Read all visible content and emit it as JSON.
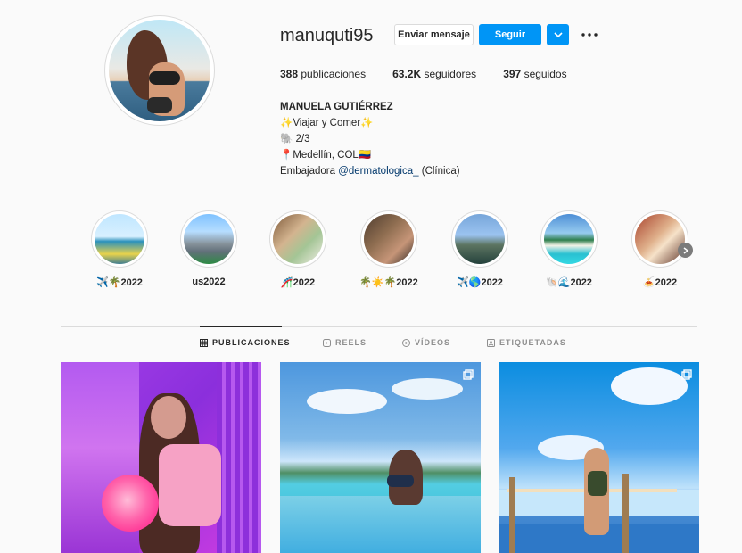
{
  "profile": {
    "username": "manuquti95",
    "buttons": {
      "message": "Enviar mensaje",
      "follow": "Seguir"
    },
    "stats": {
      "posts_count": "388",
      "posts_label": "publicaciones",
      "followers_count": "63.2K",
      "followers_label": "seguidores",
      "following_count": "397",
      "following_label": "seguidos"
    },
    "bio": {
      "name": "MANUELA GUTIÉRREZ",
      "line1": "✨Viajar y Comer✨",
      "line2": "🐘 2/3",
      "line3": "📍Medellín, COL🇨🇴",
      "line4_prefix": "Embajadora",
      "line4_link": "@dermatologica_",
      "line4_suffix": "(Clínica)"
    }
  },
  "highlights": [
    {
      "label": "✈️🌴2022"
    },
    {
      "label": "us2022"
    },
    {
      "label": "🎢2022"
    },
    {
      "label": "🌴☀️🌴2022"
    },
    {
      "label": "✈️🌎2022"
    },
    {
      "label": "🐚🌊2022"
    },
    {
      "label": "🍝2022"
    }
  ],
  "tabs": {
    "posts": "PUBLICACIONES",
    "reels": "REELS",
    "videos": "VÍDEOS",
    "tagged": "ETIQUETADAS"
  },
  "icons": {
    "more": "more-horizontal-icon",
    "dropdown": "chevron-down-icon",
    "grid": "grid-icon",
    "reels": "reels-icon",
    "video": "video-icon",
    "tagged": "tagged-icon",
    "carousel": "carousel-icon"
  },
  "colors": {
    "accent": "#0095f6",
    "link": "#00376b",
    "text": "#262626",
    "muted": "#8e8e8e",
    "background": "#fafafa"
  }
}
